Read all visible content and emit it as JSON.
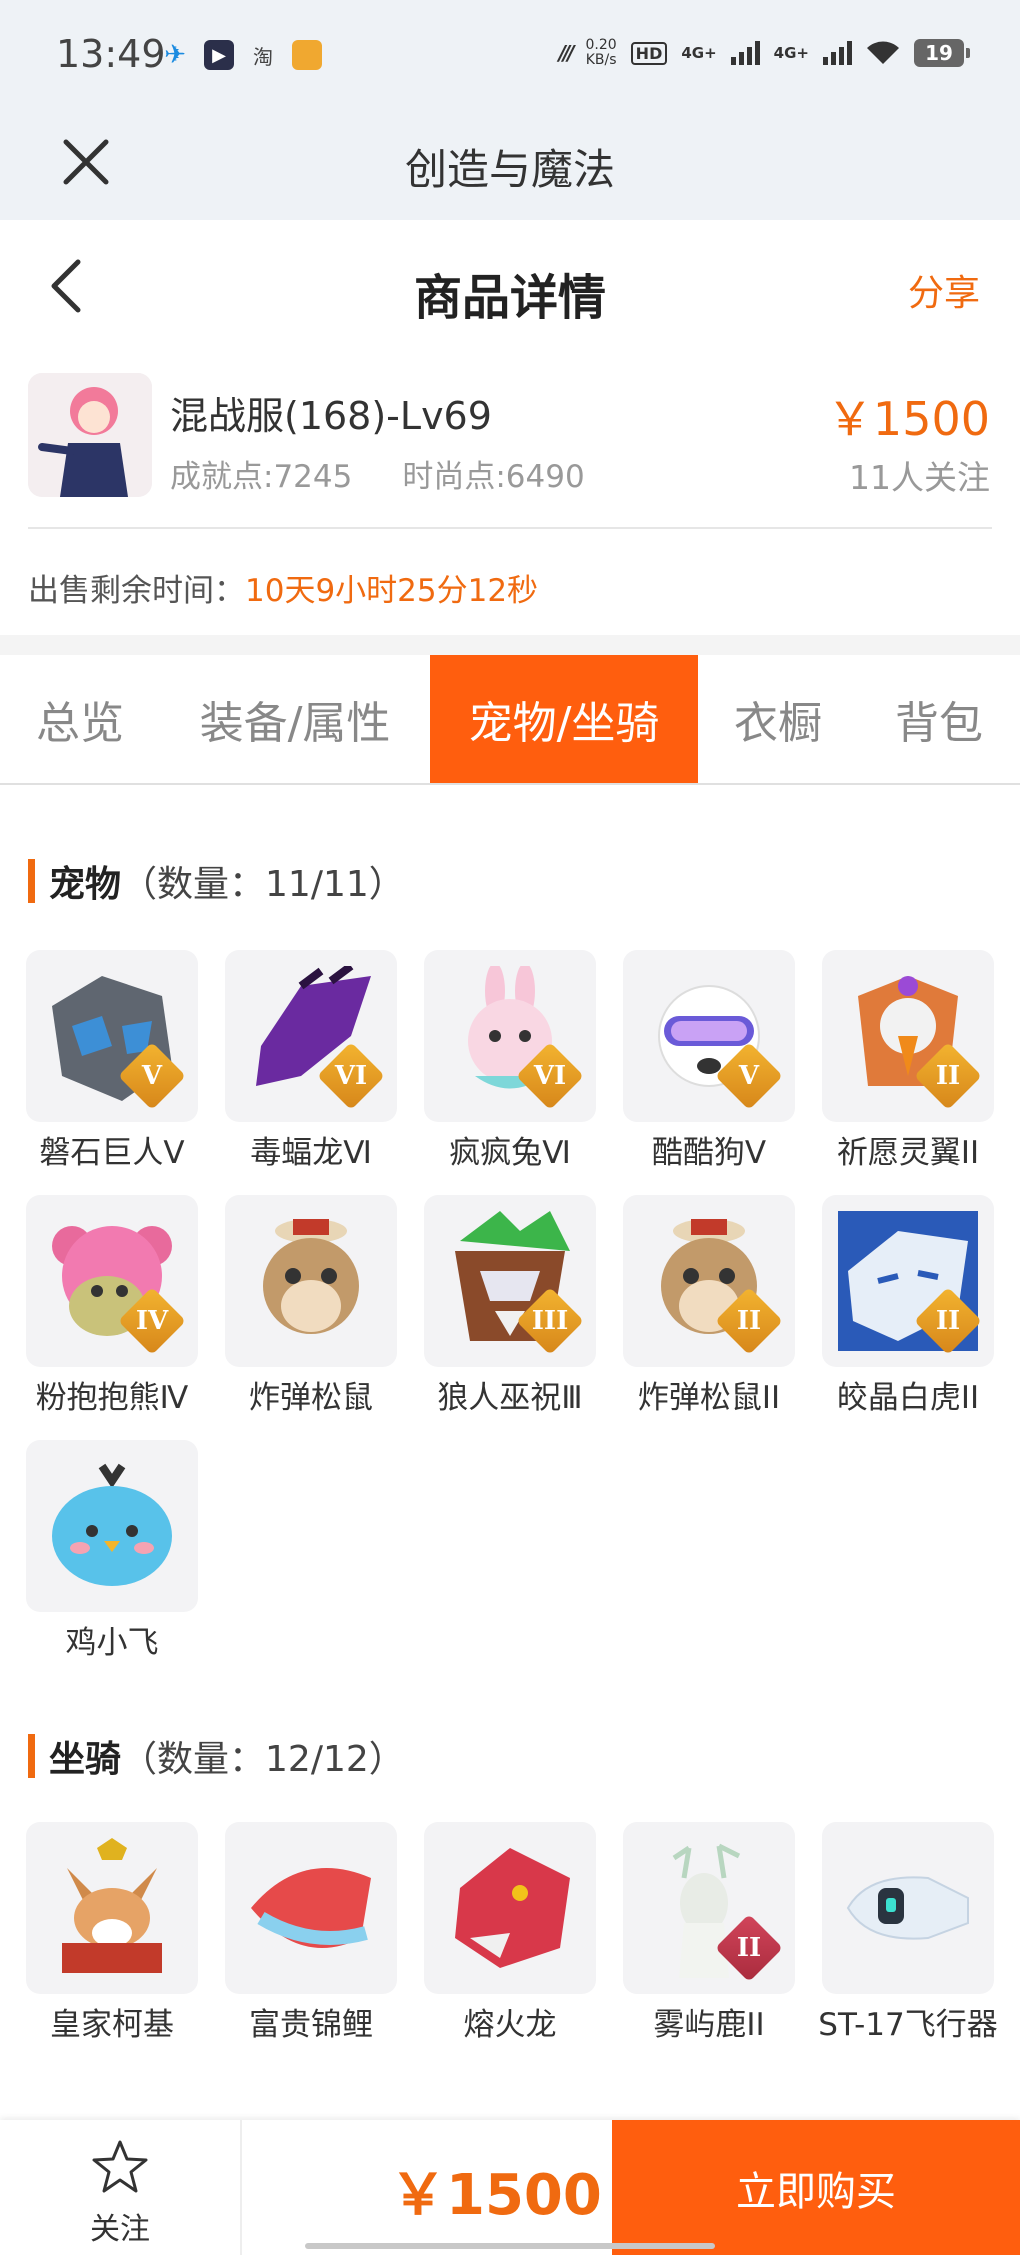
{
  "status_bar": {
    "time": "13:49",
    "net_speed": "0.20",
    "net_unit": "KB/s",
    "hd": "HD",
    "net_type_1": "4G+",
    "net_type_2": "4G+",
    "battery": "19",
    "app_taobao": "淘"
  },
  "app_bar": {
    "title": "创造与魔法"
  },
  "page_header": {
    "title": "商品详情",
    "share_label": "分享"
  },
  "product": {
    "name": "混战服(168)-Lv69",
    "achievement": "成就点:7245",
    "fashion": "时尚点:6490",
    "price": "￥1500",
    "followers": "11人关注",
    "remaining_label": "出售剩余时间：",
    "remaining_time": "10天9小时25分12秒"
  },
  "tabs": [
    {
      "label": "总览",
      "active": false
    },
    {
      "label": "装备/属性",
      "active": false
    },
    {
      "label": "宠物/坐骑",
      "active": true
    },
    {
      "label": "衣橱",
      "active": false
    },
    {
      "label": "背包",
      "active": false
    }
  ],
  "pets": {
    "title": "宠物",
    "count": "（数量：11/11）",
    "items": [
      {
        "name": "磐石巨人Ⅴ",
        "badge": "V"
      },
      {
        "name": "毒蝠龙Ⅵ",
        "badge": "VI"
      },
      {
        "name": "疯疯兔Ⅵ",
        "badge": "VI"
      },
      {
        "name": "酷酷狗Ⅴ",
        "badge": "V"
      },
      {
        "name": "祈愿灵翼II",
        "badge": "II"
      },
      {
        "name": "粉抱抱熊Ⅳ",
        "badge": "IV"
      },
      {
        "name": "炸弹松鼠",
        "badge": ""
      },
      {
        "name": "狼人巫祝Ⅲ",
        "badge": "III"
      },
      {
        "name": "炸弹松鼠II",
        "badge": "II"
      },
      {
        "name": "皎晶白虎II",
        "badge": "II"
      },
      {
        "name": "鸡小飞",
        "badge": ""
      }
    ]
  },
  "mounts": {
    "title": "坐骑",
    "count": "（数量：12/12）",
    "items": [
      {
        "name": "皇家柯基",
        "badge": ""
      },
      {
        "name": "富贵锦鲤",
        "badge": ""
      },
      {
        "name": "熔火龙",
        "badge": ""
      },
      {
        "name": "雾屿鹿II",
        "badge": "II"
      },
      {
        "name": "ST-17飞行器",
        "badge": ""
      }
    ]
  },
  "bottom_bar": {
    "follow_label": "关注",
    "price": "￥1500",
    "buy_label": "立即购买"
  },
  "colors": {
    "accent": "#ff5e0e",
    "price": "#f06a10",
    "header_bg": "#eef2f6"
  }
}
